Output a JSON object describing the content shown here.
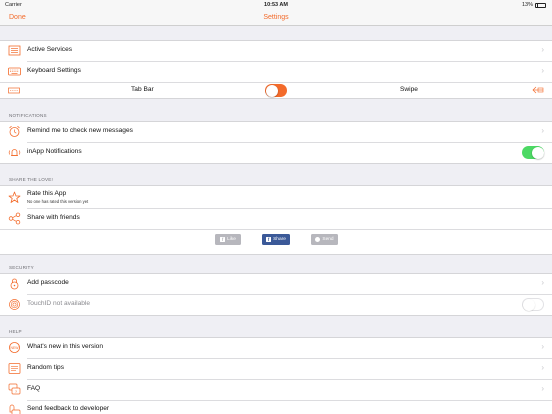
{
  "status": {
    "carrier": "Carrier",
    "time": "10:53 AM",
    "battery": "13%"
  },
  "nav": {
    "done": "Done",
    "title": "Settings"
  },
  "rows": {
    "active_services": "Active Services",
    "keyboard_settings": "Keyboard Settings",
    "tab_bar": "Tab Bar",
    "swipe": "Swipe",
    "remind": "Remind me to check new messages",
    "inapp": "inApp Notifications",
    "rate": "Rate this App",
    "rate_sub": "No one has rated this version yet",
    "share_friends": "Share with friends",
    "add_passcode": "Add passcode",
    "touchid": "TouchID not available",
    "whats_new": "What's new in this version",
    "random_tips": "Random tips",
    "faq": "FAQ",
    "feedback": "Send feedback to developer"
  },
  "sections": {
    "notifications": "NOTIFICATIONS",
    "share": "SHARE THE LOVE!",
    "security": "SECURITY",
    "help": "HELP"
  },
  "share_buttons": {
    "like": "Like",
    "share": "Share",
    "send": "Send"
  },
  "toggles": {
    "tab_bar_swipe": false,
    "inapp_notifications": true,
    "touchid": false
  },
  "colors": {
    "accent": "#f36b2b",
    "toggle_on": "#4cd964",
    "facebook": "#3b5998",
    "disabled": "#b7b7bd"
  }
}
